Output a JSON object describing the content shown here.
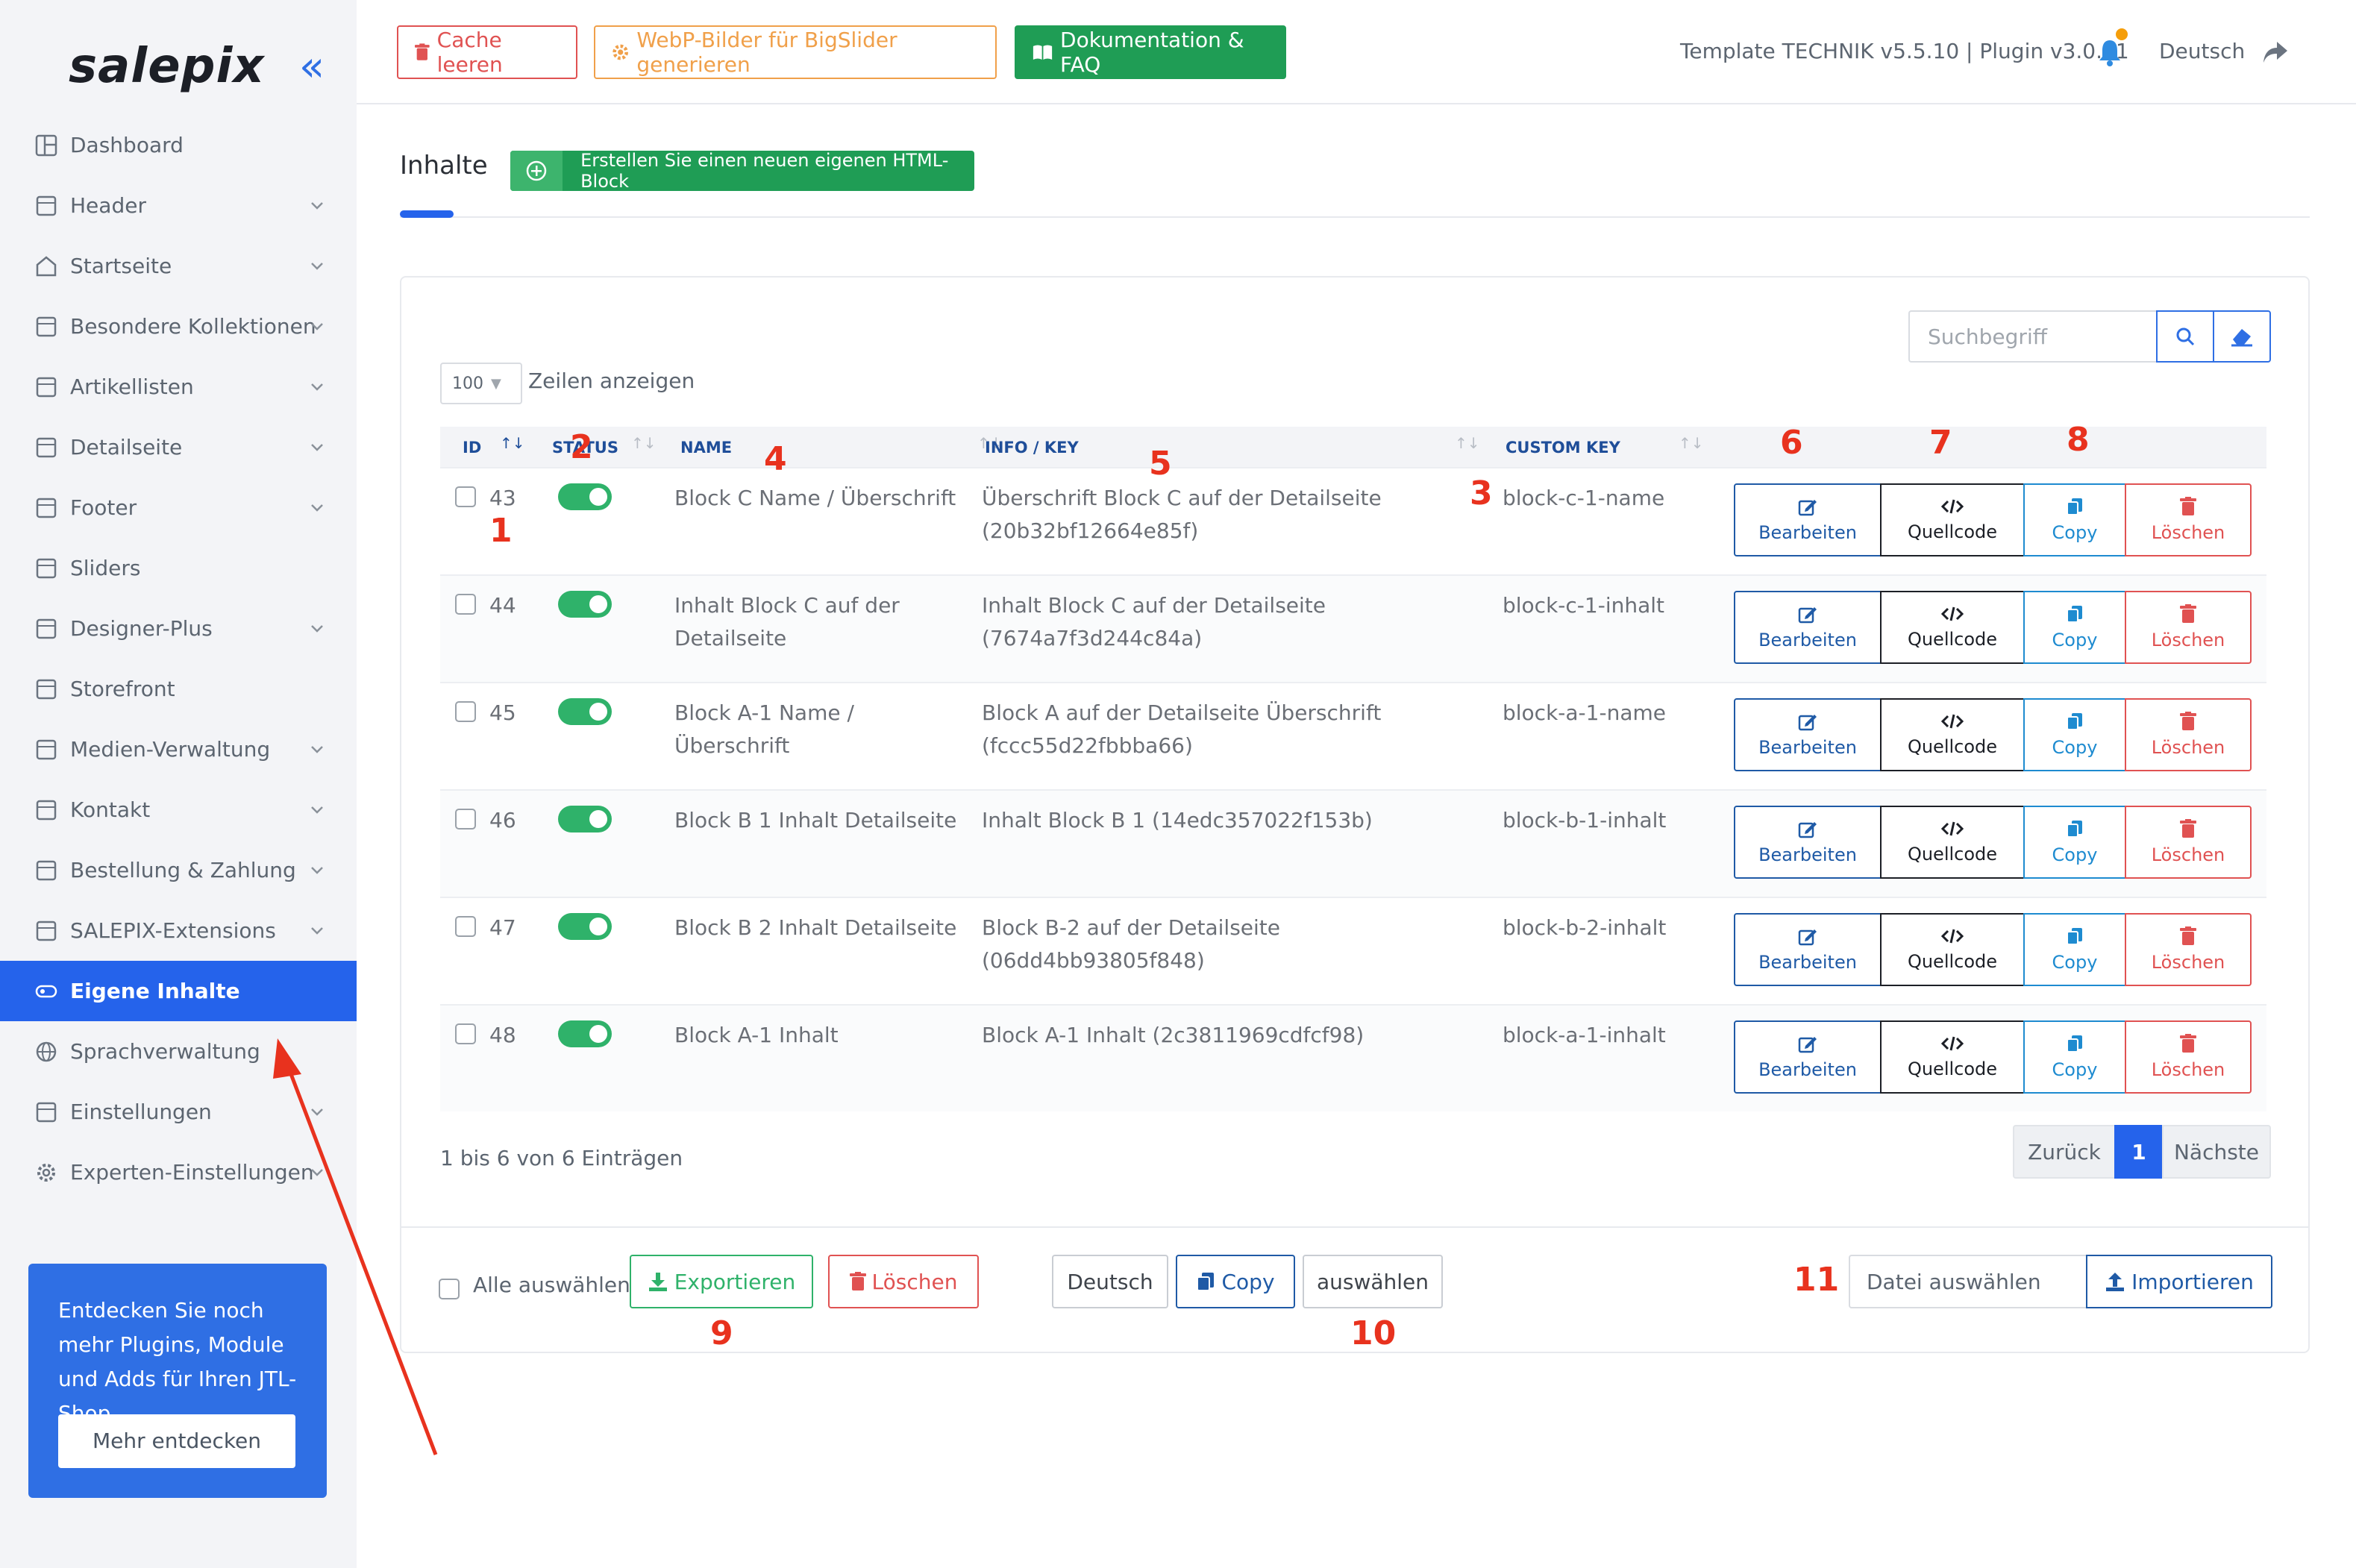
{
  "sidebar": {
    "logo": "salepix",
    "items": [
      {
        "label": "Dashboard",
        "icon": "dashboard-icon",
        "has_chevron": false
      },
      {
        "label": "Header",
        "icon": "header-icon",
        "has_chevron": true
      },
      {
        "label": "Startseite",
        "icon": "home-icon",
        "has_chevron": true
      },
      {
        "label": "Besondere Kollektionen",
        "icon": "collections-icon",
        "has_chevron": true
      },
      {
        "label": "Artikellisten",
        "icon": "list-icon",
        "has_chevron": true
      },
      {
        "label": "Detailseite",
        "icon": "detail-page-icon",
        "has_chevron": true
      },
      {
        "label": "Footer",
        "icon": "footer-icon",
        "has_chevron": true
      },
      {
        "label": "Sliders",
        "icon": "slider-icon",
        "has_chevron": false
      },
      {
        "label": "Designer-Plus",
        "icon": "designer-icon",
        "has_chevron": true
      },
      {
        "label": "Storefront",
        "icon": "storefront-icon",
        "has_chevron": false
      },
      {
        "label": "Medien-Verwaltung",
        "icon": "media-icon",
        "has_chevron": true
      },
      {
        "label": "Kontakt",
        "icon": "contact-icon",
        "has_chevron": true
      },
      {
        "label": "Bestellung & Zahlung",
        "icon": "payment-icon",
        "has_chevron": true
      },
      {
        "label": "SALEPIX-Extensions",
        "icon": "extensions-icon",
        "has_chevron": true
      },
      {
        "label": "Eigene Inhalte",
        "icon": "custom-content-icon",
        "has_chevron": false,
        "active": true
      },
      {
        "label": "Sprachverwaltung",
        "icon": "globe-icon",
        "has_chevron": false
      },
      {
        "label": "Einstellungen",
        "icon": "settings-grid-icon",
        "has_chevron": true
      },
      {
        "label": "Experten-Einstellungen",
        "icon": "gear-icon",
        "has_chevron": true
      }
    ],
    "promo": {
      "text": "Entdecken Sie noch mehr Plugins, Module und Adds für Ihren JTL-Shop",
      "button": "Mehr entdecken"
    }
  },
  "topbar": {
    "cache_btn": "Cache leeren",
    "webp_btn": "WebP-Bilder für BigSlider generieren",
    "docs_btn": "Dokumentation & FAQ",
    "template_info": "Template TECHNIK v5.5.10 | Plugin v3.0.31",
    "language": "Deutsch"
  },
  "page": {
    "title": "Inhalte",
    "create_btn": "Erstellen Sie einen neuen eigenen HTML-Block"
  },
  "table": {
    "search_placeholder": "Suchbegriff",
    "page_length": "100",
    "page_length_label": "Zeilen anzeigen",
    "columns": {
      "id": "ID",
      "status": "STATUS",
      "name": "NAME",
      "info": "INFO / KEY",
      "custom_key": "CUSTOM KEY"
    },
    "actions": {
      "edit": "Bearbeiten",
      "source": "Quellcode",
      "copy": "Copy",
      "delete": "Löschen"
    },
    "rows": [
      {
        "id": "43",
        "status": true,
        "name": [
          "Block C Name / Überschrift",
          ""
        ],
        "info": [
          "Überschrift Block C auf der Detailseite",
          "(20b32bf12664e85f)"
        ],
        "key": "block-c-1-name"
      },
      {
        "id": "44",
        "status": true,
        "name": [
          "Inhalt Block C auf der",
          "Detailseite"
        ],
        "info": [
          "Inhalt Block C auf der Detailseite",
          "(7674a7f3d244c84a)"
        ],
        "key": "block-c-1-inhalt"
      },
      {
        "id": "45",
        "status": true,
        "name": [
          "Block A-1 Name / Überschrift",
          ""
        ],
        "info": [
          "Block A auf der Detailseite Überschrift",
          "(fccc55d22fbbba66)"
        ],
        "key": "block-a-1-name"
      },
      {
        "id": "46",
        "status": true,
        "name": [
          "Block B 1 Inhalt Detailseite",
          ""
        ],
        "info": [
          "Inhalt Block B 1 (14edc357022f153b)",
          ""
        ],
        "key": "block-b-1-inhalt"
      },
      {
        "id": "47",
        "status": true,
        "name": [
          "Block B 2 Inhalt Detailseite",
          ""
        ],
        "info": [
          "Block B-2 auf der Detailseite (06dd4bb93805f848)",
          ""
        ],
        "key": "block-b-2-inhalt"
      },
      {
        "id": "48",
        "status": true,
        "name": [
          "Block A-1 Inhalt",
          ""
        ],
        "info": [
          "Block A-1 Inhalt (2c3811969cdfcf98)",
          ""
        ],
        "key": "block-a-1-inhalt"
      }
    ],
    "info_text": "1 bis 6 von 6 Einträgen",
    "pager": {
      "prev": "Zurück",
      "page": "1",
      "next": "Nächste"
    }
  },
  "footer": {
    "select_all": "Alle auswählen",
    "export": "Exportieren",
    "delete": "Löschen",
    "lang_btn": "Deutsch",
    "copy": "Copy",
    "select": "auswählen",
    "file_select": "Datei auswählen",
    "import": "Importieren"
  },
  "annotations": [
    "1",
    "2",
    "3",
    "4",
    "5",
    "6",
    "7",
    "8",
    "9",
    "10",
    "11"
  ],
  "colors": {
    "primary": "#2563eb",
    "success": "#1f9d55",
    "danger": "#e05252",
    "warning": "#f0a04a",
    "annotation": "#e8321e"
  }
}
